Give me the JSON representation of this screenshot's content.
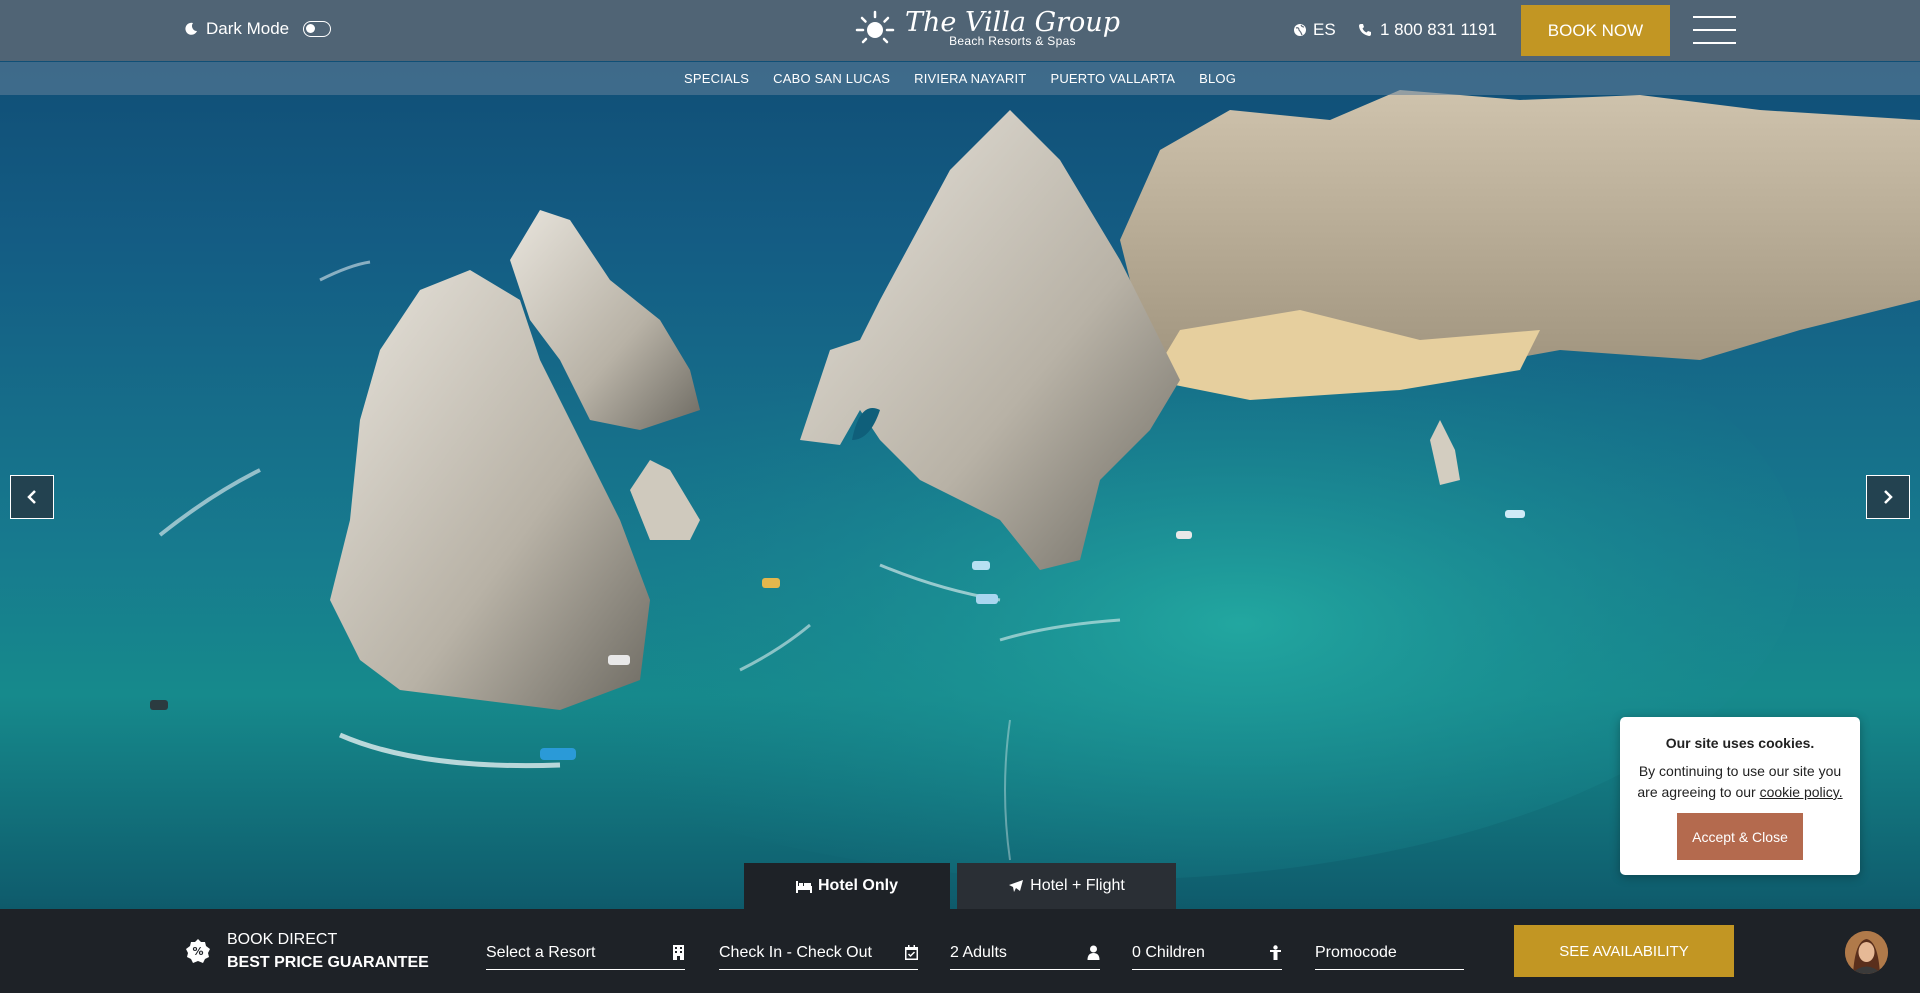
{
  "header": {
    "dark_mode_label": "Dark Mode",
    "logo_main": "The Villa Group",
    "logo_sub": "Beach Resorts & Spas",
    "language": "ES",
    "phone": "1 800 831 1191",
    "book_now": "BOOK NOW"
  },
  "subnav": {
    "items": [
      "SPECIALS",
      "CABO SAN LUCAS",
      "RIVIERA NAYARIT",
      "PUERTO VALLARTA",
      "BLOG"
    ]
  },
  "booking": {
    "tabs": [
      "Hotel Only",
      "Hotel + Flight"
    ],
    "guarantee_line1": "BOOK DIRECT",
    "guarantee_line2": "BEST PRICE GUARANTEE",
    "resort_placeholder": "Select a Resort",
    "dates_placeholder": "Check In - Check Out",
    "adults": "2 Adults",
    "children": "0 Children",
    "promo_placeholder": "Promocode",
    "submit": "SEE AVAILABILITY"
  },
  "cookie": {
    "title": "Our site uses cookies.",
    "body": "By continuing to use our site you are agreeing to our",
    "link": "cookie policy.",
    "button": "Accept & Close"
  },
  "colors": {
    "accent_gold": "#c29623",
    "cookie_button": "#b46a4e",
    "booking_bar": "#1e2227"
  },
  "icons": [
    "moon-icon",
    "sun-logo-icon",
    "globe-icon",
    "phone-icon",
    "menu-icon",
    "chevron-left-icon",
    "chevron-right-icon",
    "bed-icon",
    "plane-icon",
    "percent-icon",
    "building-icon",
    "calendar-icon",
    "user-icon",
    "child-icon"
  ]
}
